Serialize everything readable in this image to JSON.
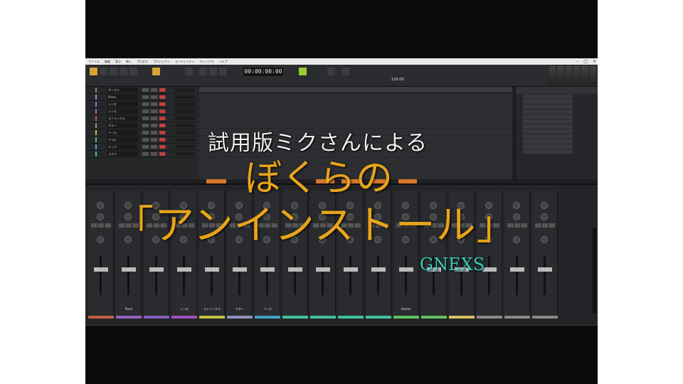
{
  "app": {
    "timecode": "00:00:00:00",
    "tempo": "120.00"
  },
  "menu": [
    "ファイル",
    "編集",
    "表示",
    "挿入",
    "プロセス",
    "プロジェクト",
    "ユーティリティ",
    "ウィンドウ",
    "ヘルプ"
  ],
  "tracks": [
    {
      "name": "ボーカル",
      "color": "#c07050"
    },
    {
      "name": "Piano",
      "color": "#9090d0"
    },
    {
      "name": "シンセ",
      "color": "#8080c0"
    },
    {
      "name": "シンセ",
      "color": "#c050c0"
    },
    {
      "name": "ストリングス",
      "color": "#c05050"
    },
    {
      "name": "ギター",
      "color": "#9090c0"
    },
    {
      "name": "ベース",
      "color": "#c0c040"
    },
    {
      "name": "ドラム",
      "color": "#50c080"
    },
    {
      "name": "キック",
      "color": "#50a0c0"
    },
    {
      "name": "スネア",
      "color": "#40c0a0"
    }
  ],
  "mixer": {
    "strips": [
      {
        "label": "",
        "color": "#c06040"
      },
      {
        "label": "Piano",
        "color": "#9060c0"
      },
      {
        "label": "",
        "color": "#8060c0"
      },
      {
        "label": "シンセ",
        "color": "#a050c0"
      },
      {
        "label": "ストリングス",
        "color": "#c0c040"
      },
      {
        "label": "ギター",
        "color": "#9090c0"
      },
      {
        "label": "ベース",
        "color": "#40a0c0"
      },
      {
        "label": "",
        "color": "#40c0a0"
      },
      {
        "label": "",
        "color": "#40c0a0"
      },
      {
        "label": "",
        "color": "#40c0a0"
      },
      {
        "label": "",
        "color": "#40c0a0"
      },
      {
        "label": "Master",
        "color": "#60c060"
      },
      {
        "label": "",
        "color": "#60c060"
      },
      {
        "label": "",
        "color": "#d8c060"
      },
      {
        "label": "",
        "color": "#888888"
      },
      {
        "label": "",
        "color": "#888888"
      },
      {
        "label": "",
        "color": "#888888"
      }
    ]
  },
  "overlay": {
    "line1": "試用版ミクさんによる",
    "line2": "ぼくらの",
    "line3": "「アンインストール」",
    "credit": "GNEXS"
  },
  "colors": {
    "accent": "#d8a23a",
    "title_orange": "#e7a41c",
    "credit_teal": "#38c9b8"
  }
}
